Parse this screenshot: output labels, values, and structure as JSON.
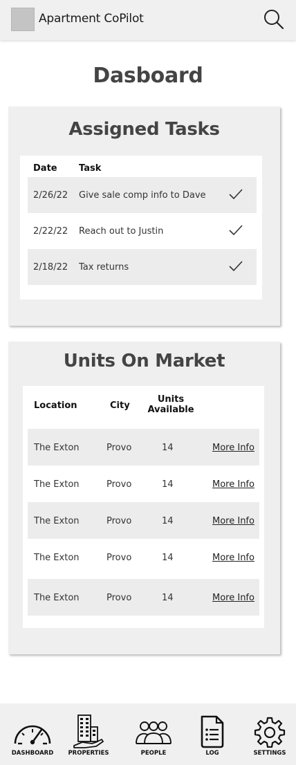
{
  "header": {
    "app_title": "Apartment CoPilot",
    "logo": "logo-placeholder",
    "search_icon": "search-icon"
  },
  "page": {
    "title": "Dasboard"
  },
  "assigned_tasks": {
    "title": "Assigned Tasks",
    "columns": [
      "Date",
      "Task"
    ],
    "rows": [
      {
        "date": "2/26/22",
        "task": "Give sale comp info to Dave",
        "status_icon": "checkmark-icon"
      },
      {
        "date": "2/22/22",
        "task": "Reach out to Justin",
        "status_icon": "checkmark-icon"
      },
      {
        "date": "2/18/22",
        "task": "Tax returns",
        "status_icon": "checkmark-icon"
      }
    ]
  },
  "units_on_market": {
    "title": "Units On Market",
    "columns": {
      "location": "Location",
      "city": "City",
      "units_line1": "Units",
      "units_line2": "Available"
    },
    "rows": [
      {
        "location": "The Exton",
        "city": "Provo",
        "units": "14",
        "link": "More Info"
      },
      {
        "location": "The Exton",
        "city": "Provo",
        "units": "14",
        "link": "More Info"
      },
      {
        "location": "The Exton",
        "city": "Provo",
        "units": "14",
        "link": "More Info"
      },
      {
        "location": "The Exton",
        "city": "Provo",
        "units": "14",
        "link": "More Info"
      },
      {
        "location": "The Exton",
        "city": "Provo",
        "units": "14",
        "link": "More Info"
      }
    ]
  },
  "bottom_nav": {
    "items": [
      {
        "label": "DASHBOARD",
        "icon": "dashboard-gauge-icon"
      },
      {
        "label": "PROPERTIES",
        "icon": "building-icon"
      },
      {
        "label": "PEOPLE",
        "icon": "people-icon"
      },
      {
        "label": "LOG",
        "icon": "log-document-icon"
      },
      {
        "label": "SETTINGS",
        "icon": "gear-icon"
      }
    ]
  }
}
